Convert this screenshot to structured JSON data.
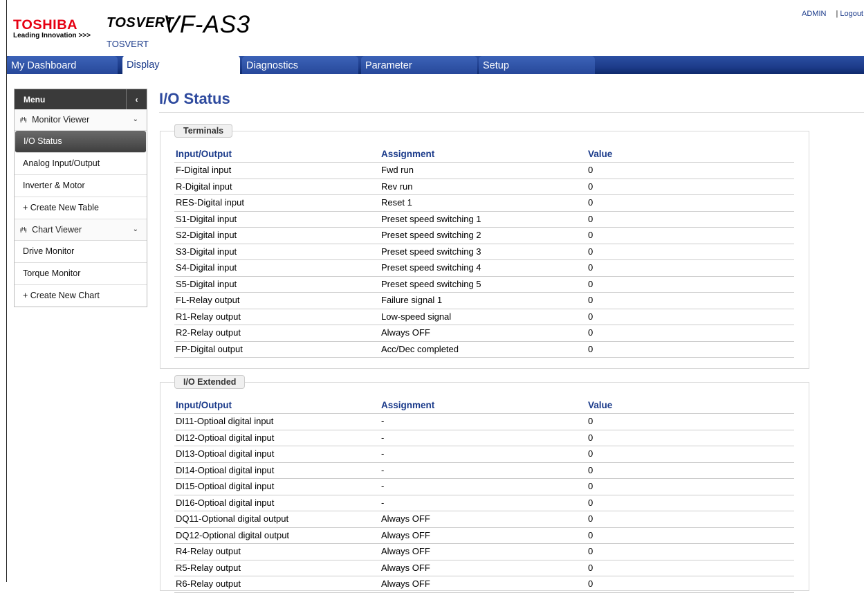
{
  "header": {
    "brand": "TOSHIBA",
    "tagline": "Leading Innovation >>>",
    "product_brand": "TOSVERT",
    "product_model": "VF-AS3",
    "product_sub": "TOSVERT",
    "user": "ADMIN",
    "separator": "|",
    "logout": "Logout"
  },
  "nav": {
    "tabs": [
      {
        "label": "My Dashboard"
      },
      {
        "label": "Display"
      },
      {
        "label": "Diagnostics"
      },
      {
        "label": "Parameter"
      },
      {
        "label": "Setup"
      }
    ],
    "active_tab": "Display"
  },
  "sidebar": {
    "menu_label": "Menu",
    "collapse_glyph": "‹",
    "groups": [
      {
        "label": "Monitor Viewer",
        "icon": "waveform-icon",
        "items": [
          "I/O Status",
          "Analog Input/Output",
          "Inverter & Motor",
          "+ Create New Table"
        ]
      },
      {
        "label": "Chart Viewer",
        "icon": "waveform-icon",
        "items": [
          "Drive Monitor",
          "Torque Monitor",
          "+ Create New Chart"
        ]
      }
    ],
    "active_item": "I/O Status"
  },
  "main": {
    "title": "I/O Status",
    "terminals": {
      "legend": "Terminals",
      "headers": [
        "Input/Output",
        "Assignment",
        "Value"
      ],
      "rows": [
        [
          "F-Digital input",
          "Fwd run",
          "0"
        ],
        [
          "R-Digital input",
          "Rev run",
          "0"
        ],
        [
          "RES-Digital input",
          "Reset 1",
          "0"
        ],
        [
          "S1-Digital input",
          "Preset speed switching 1",
          "0"
        ],
        [
          "S2-Digital input",
          "Preset speed switching 2",
          "0"
        ],
        [
          "S3-Digital input",
          "Preset speed switching 3",
          "0"
        ],
        [
          "S4-Digital input",
          "Preset speed switching 4",
          "0"
        ],
        [
          "S5-Digital input",
          "Preset speed switching 5",
          "0"
        ],
        [
          "FL-Relay output",
          "Failure signal 1",
          "0"
        ],
        [
          "R1-Relay output",
          "Low-speed signal",
          "0"
        ],
        [
          "R2-Relay output",
          "Always OFF",
          "0"
        ],
        [
          "FP-Digital output",
          "Acc/Dec completed",
          "0"
        ]
      ]
    },
    "io_extended": {
      "legend": "I/O Extended",
      "headers": [
        "Input/Output",
        "Assignment",
        "Value"
      ],
      "rows": [
        [
          "DI11-Optioal digital input",
          "-",
          "0"
        ],
        [
          "DI12-Optioal digital input",
          "-",
          "0"
        ],
        [
          "DI13-Optioal digital input",
          "-",
          "0"
        ],
        [
          "DI14-Optioal digital input",
          "-",
          "0"
        ],
        [
          "DI15-Optioal digital input",
          "-",
          "0"
        ],
        [
          "DI16-Optioal digital input",
          "-",
          "0"
        ],
        [
          "DQ11-Optional digital output",
          "Always OFF",
          "0"
        ],
        [
          "DQ12-Optional digital output",
          "Always OFF",
          "0"
        ],
        [
          "R4-Relay output",
          "Always OFF",
          "0"
        ],
        [
          "R5-Relay output",
          "Always OFF",
          "0"
        ],
        [
          "R6-Relay output",
          "Always OFF",
          "0"
        ]
      ]
    }
  }
}
